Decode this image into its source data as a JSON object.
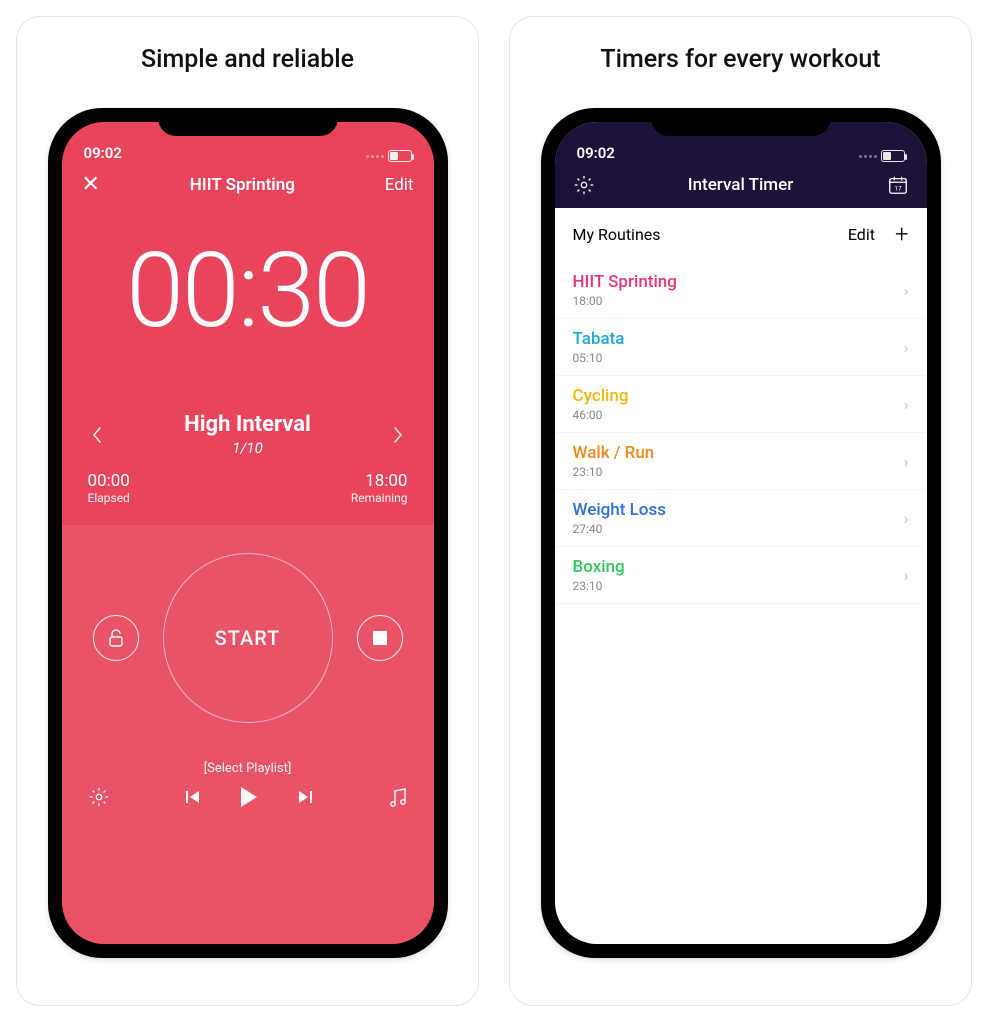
{
  "panels": {
    "left_title": "Simple and reliable",
    "right_title": "Timers for every workout"
  },
  "status": {
    "time": "09:02"
  },
  "timer": {
    "nav": {
      "close": "✕",
      "title": "HIIT Sprinting",
      "edit": "Edit"
    },
    "countdown": "00:30",
    "interval": {
      "name": "High Interval",
      "count": "1/10"
    },
    "elapsed": {
      "value": "00:00",
      "label": "Elapsed"
    },
    "remaining": {
      "value": "18:00",
      "label": "Remaining"
    },
    "start_label": "START",
    "playlist_label": "[Select Playlist]"
  },
  "list_screen": {
    "nav_title": "Interval Timer",
    "section_title": "My Routines",
    "edit_label": "Edit",
    "routines": [
      {
        "name": "HIIT Sprinting",
        "duration": "18:00",
        "color": "#e5396f"
      },
      {
        "name": "Tabata",
        "duration": "05:10",
        "color": "#1fa9d6"
      },
      {
        "name": "Cycling",
        "duration": "46:00",
        "color": "#f2b90f"
      },
      {
        "name": "Walk / Run",
        "duration": "23:10",
        "color": "#f28a1c"
      },
      {
        "name": "Weight Loss",
        "duration": "27:40",
        "color": "#2f6fd6"
      },
      {
        "name": "Boxing",
        "duration": "23:10",
        "color": "#36c85b"
      }
    ]
  }
}
